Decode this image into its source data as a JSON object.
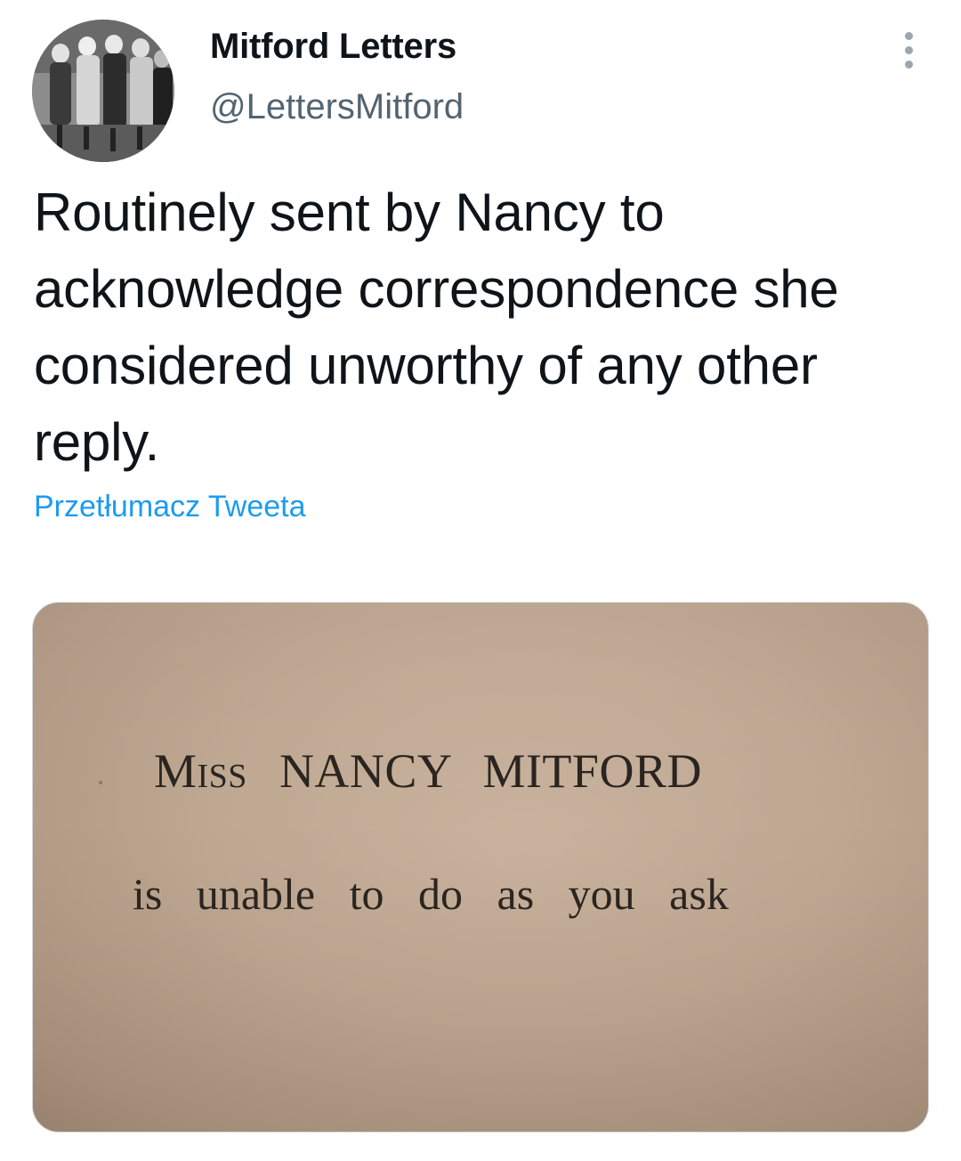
{
  "tweet": {
    "author": {
      "display_name": "Mitford Letters",
      "handle": "@LettersMitford",
      "avatar_icon": "group-photo-avatar"
    },
    "more_icon": "more-options-icon",
    "text": "Routinely sent by Nancy to acknowledge correspondence she considered unworthy of any other reply.",
    "translate_label": "Przetłumacz Tweeta",
    "media": {
      "card_line_1_prefix": "Miss",
      "card_line_1_rest": "NANCY MITFORD",
      "card_line_2": "is unable to do as you ask"
    }
  },
  "colors": {
    "text_primary": "#0f1419",
    "text_secondary": "#536471",
    "link": "#1d9bf0",
    "card_paper": "#c4ad97"
  }
}
